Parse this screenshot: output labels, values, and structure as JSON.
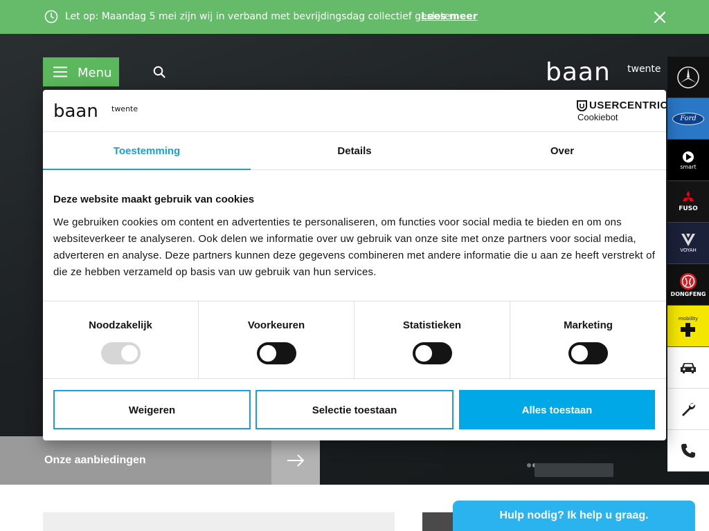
{
  "banner": {
    "message": "Let op: Maandag 5 mei zijn wij in verband met bevrijdingsdag collectief gesloten",
    "link": "Lees meer"
  },
  "header": {
    "menu_label": "Menu",
    "logo_main": "baan",
    "logo_sub": "twente"
  },
  "brands": [
    {
      "name": "mercedes",
      "caption": ""
    },
    {
      "name": "ford",
      "caption": "Ford"
    },
    {
      "name": "smart",
      "caption": "smart"
    },
    {
      "name": "fuso",
      "caption": "FUSO"
    },
    {
      "name": "voyah",
      "caption": "VOYAH"
    },
    {
      "name": "dongfeng",
      "caption": "DONGFENG"
    },
    {
      "name": "mobility-plus",
      "caption": "mobility"
    }
  ],
  "offers": {
    "label": "Onze aanbiedingen"
  },
  "help": {
    "label": "Hulp nodig? Ik help u graag."
  },
  "dialog": {
    "logo_main": "baan",
    "logo_sub": "twente",
    "provider_line1": "USERCENTRICS",
    "provider_line2": "Cookiebot",
    "tabs": [
      {
        "label": "Toestemming"
      },
      {
        "label": "Details"
      },
      {
        "label": "Over"
      }
    ],
    "title": "Deze website maakt gebruik van cookies",
    "text": "We gebruiken cookies om content en advertenties te personaliseren, om functies voor social media te bieden en om ons websiteverkeer te analyseren. Ook delen we informatie over uw gebruik van onze site met onze partners voor social media, adverteren en analyse. Deze partners kunnen deze gegevens combineren met andere informatie die u aan ze heeft verstrekt of die ze hebben verzameld op basis van uw gebruik van hun services.",
    "categories": [
      {
        "label": "Noodzakelijk",
        "enabled": true
      },
      {
        "label": "Voorkeuren",
        "enabled": false
      },
      {
        "label": "Statistieken",
        "enabled": false
      },
      {
        "label": "Marketing",
        "enabled": false
      }
    ],
    "buttons": {
      "deny": "Weigeren",
      "selection": "Selectie toestaan",
      "allow_all": "Alles toestaan"
    }
  },
  "colors": {
    "banner": "#66bb6a",
    "menu": "#5cb85c",
    "accent": "#1aa0d8",
    "primary_button": "#00a8e8"
  }
}
